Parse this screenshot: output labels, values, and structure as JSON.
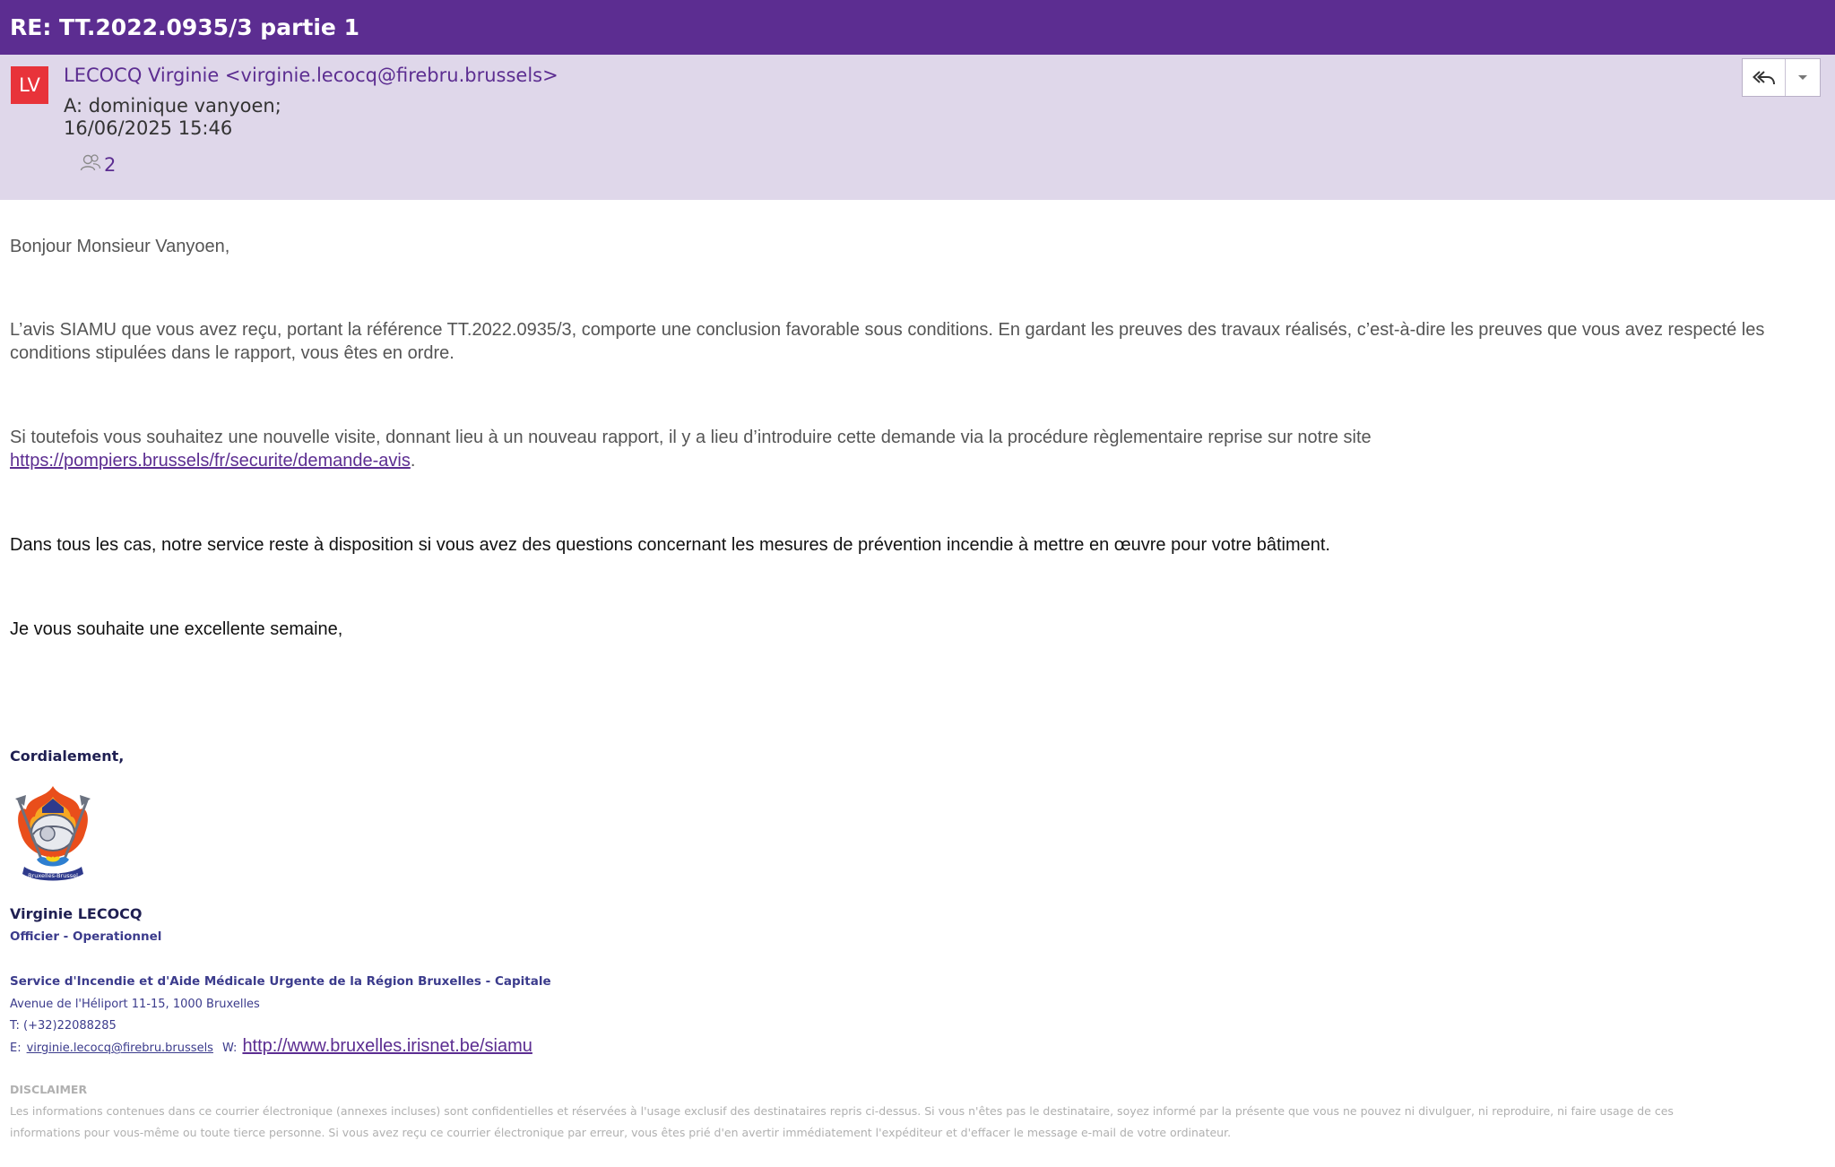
{
  "email": {
    "subject": "RE: TT.2022.0935/3 partie 1",
    "avatar_initials": "LV",
    "sender": "LECOCQ Virginie <virginie.lecocq@firebru.brussels>",
    "to": "A: dominique vanyoen;",
    "date": "16/06/2025 15:46",
    "participants_count": "2"
  },
  "body": {
    "greeting": "Bonjour Monsieur Vanyoen,",
    "p1": "L’avis SIAMU que vous avez reçu, portant la référence TT.2022.0935/3, comporte une conclusion favorable sous conditions. En gardant les preuves des travaux réalisés, c’est-à-dire les preuves que vous avez respecté les conditions stipulées dans le rapport, vous êtes en ordre.",
    "p2_text": "Si toutefois vous souhaitez une nouvelle visite, donnant lieu à un nouveau rapport, il y a lieu d’introduire cette demande via la procédure règlementaire reprise sur notre site",
    "p2_link": "https://pompiers.brussels/fr/securite/demande-avis",
    "p2_end": ".",
    "p3": "Dans tous les cas, notre service reste à disposition si vous avez des questions concernant les mesures de prévention incendie à mettre en œuvre pour votre bâtiment.",
    "p4": "Je vous souhaite une excellente semaine,"
  },
  "signature": {
    "closing": "Cordialement,",
    "name": "Virginie LECOCQ",
    "role": "Officier - Operationnel",
    "org": "Service d'Incendie et d'Aide Médicale Urgente de la Région Bruxelles - Capitale",
    "address": "Avenue de l'Héliport 11-15, 1000 Bruxelles",
    "phone": "T: (+32)22088285",
    "email_label": "E:",
    "email": "virginie.lecocq@firebru.brussels",
    "web_label": "W:",
    "web": "http://www.bruxelles.irisnet.be/siamu",
    "logo_text": "Bruxelles-Brussel",
    "disclaimer_title": "DISCLAIMER",
    "disclaimer_line1": "Les informations contenues dans ce courrier électronique (annexes incluses) sont confidentielles et réservées à l'usage exclusif des destinataires repris ci-dessus. Si vous n'êtes pas le destinataire, soyez informé par la présente que vous ne pouvez ni divulguer, ni reproduire, ni faire usage de ces",
    "disclaimer_line2": "informations pour vous-même ou toute tierce personne. Si vous avez reçu ce courrier électronique par erreur, vous êtes prié d'en avertir immédiatement l'expéditeur et d'effacer le message e-mail de votre ordinateur."
  },
  "colors": {
    "title_bar": "#5c2d91",
    "header_bg": "#dfd7ea",
    "avatar_bg": "#e8333a",
    "link": "#5c2d91"
  },
  "icons": {
    "reply": "reply-all-icon",
    "more": "chevron-down-icon",
    "people": "people-icon"
  }
}
